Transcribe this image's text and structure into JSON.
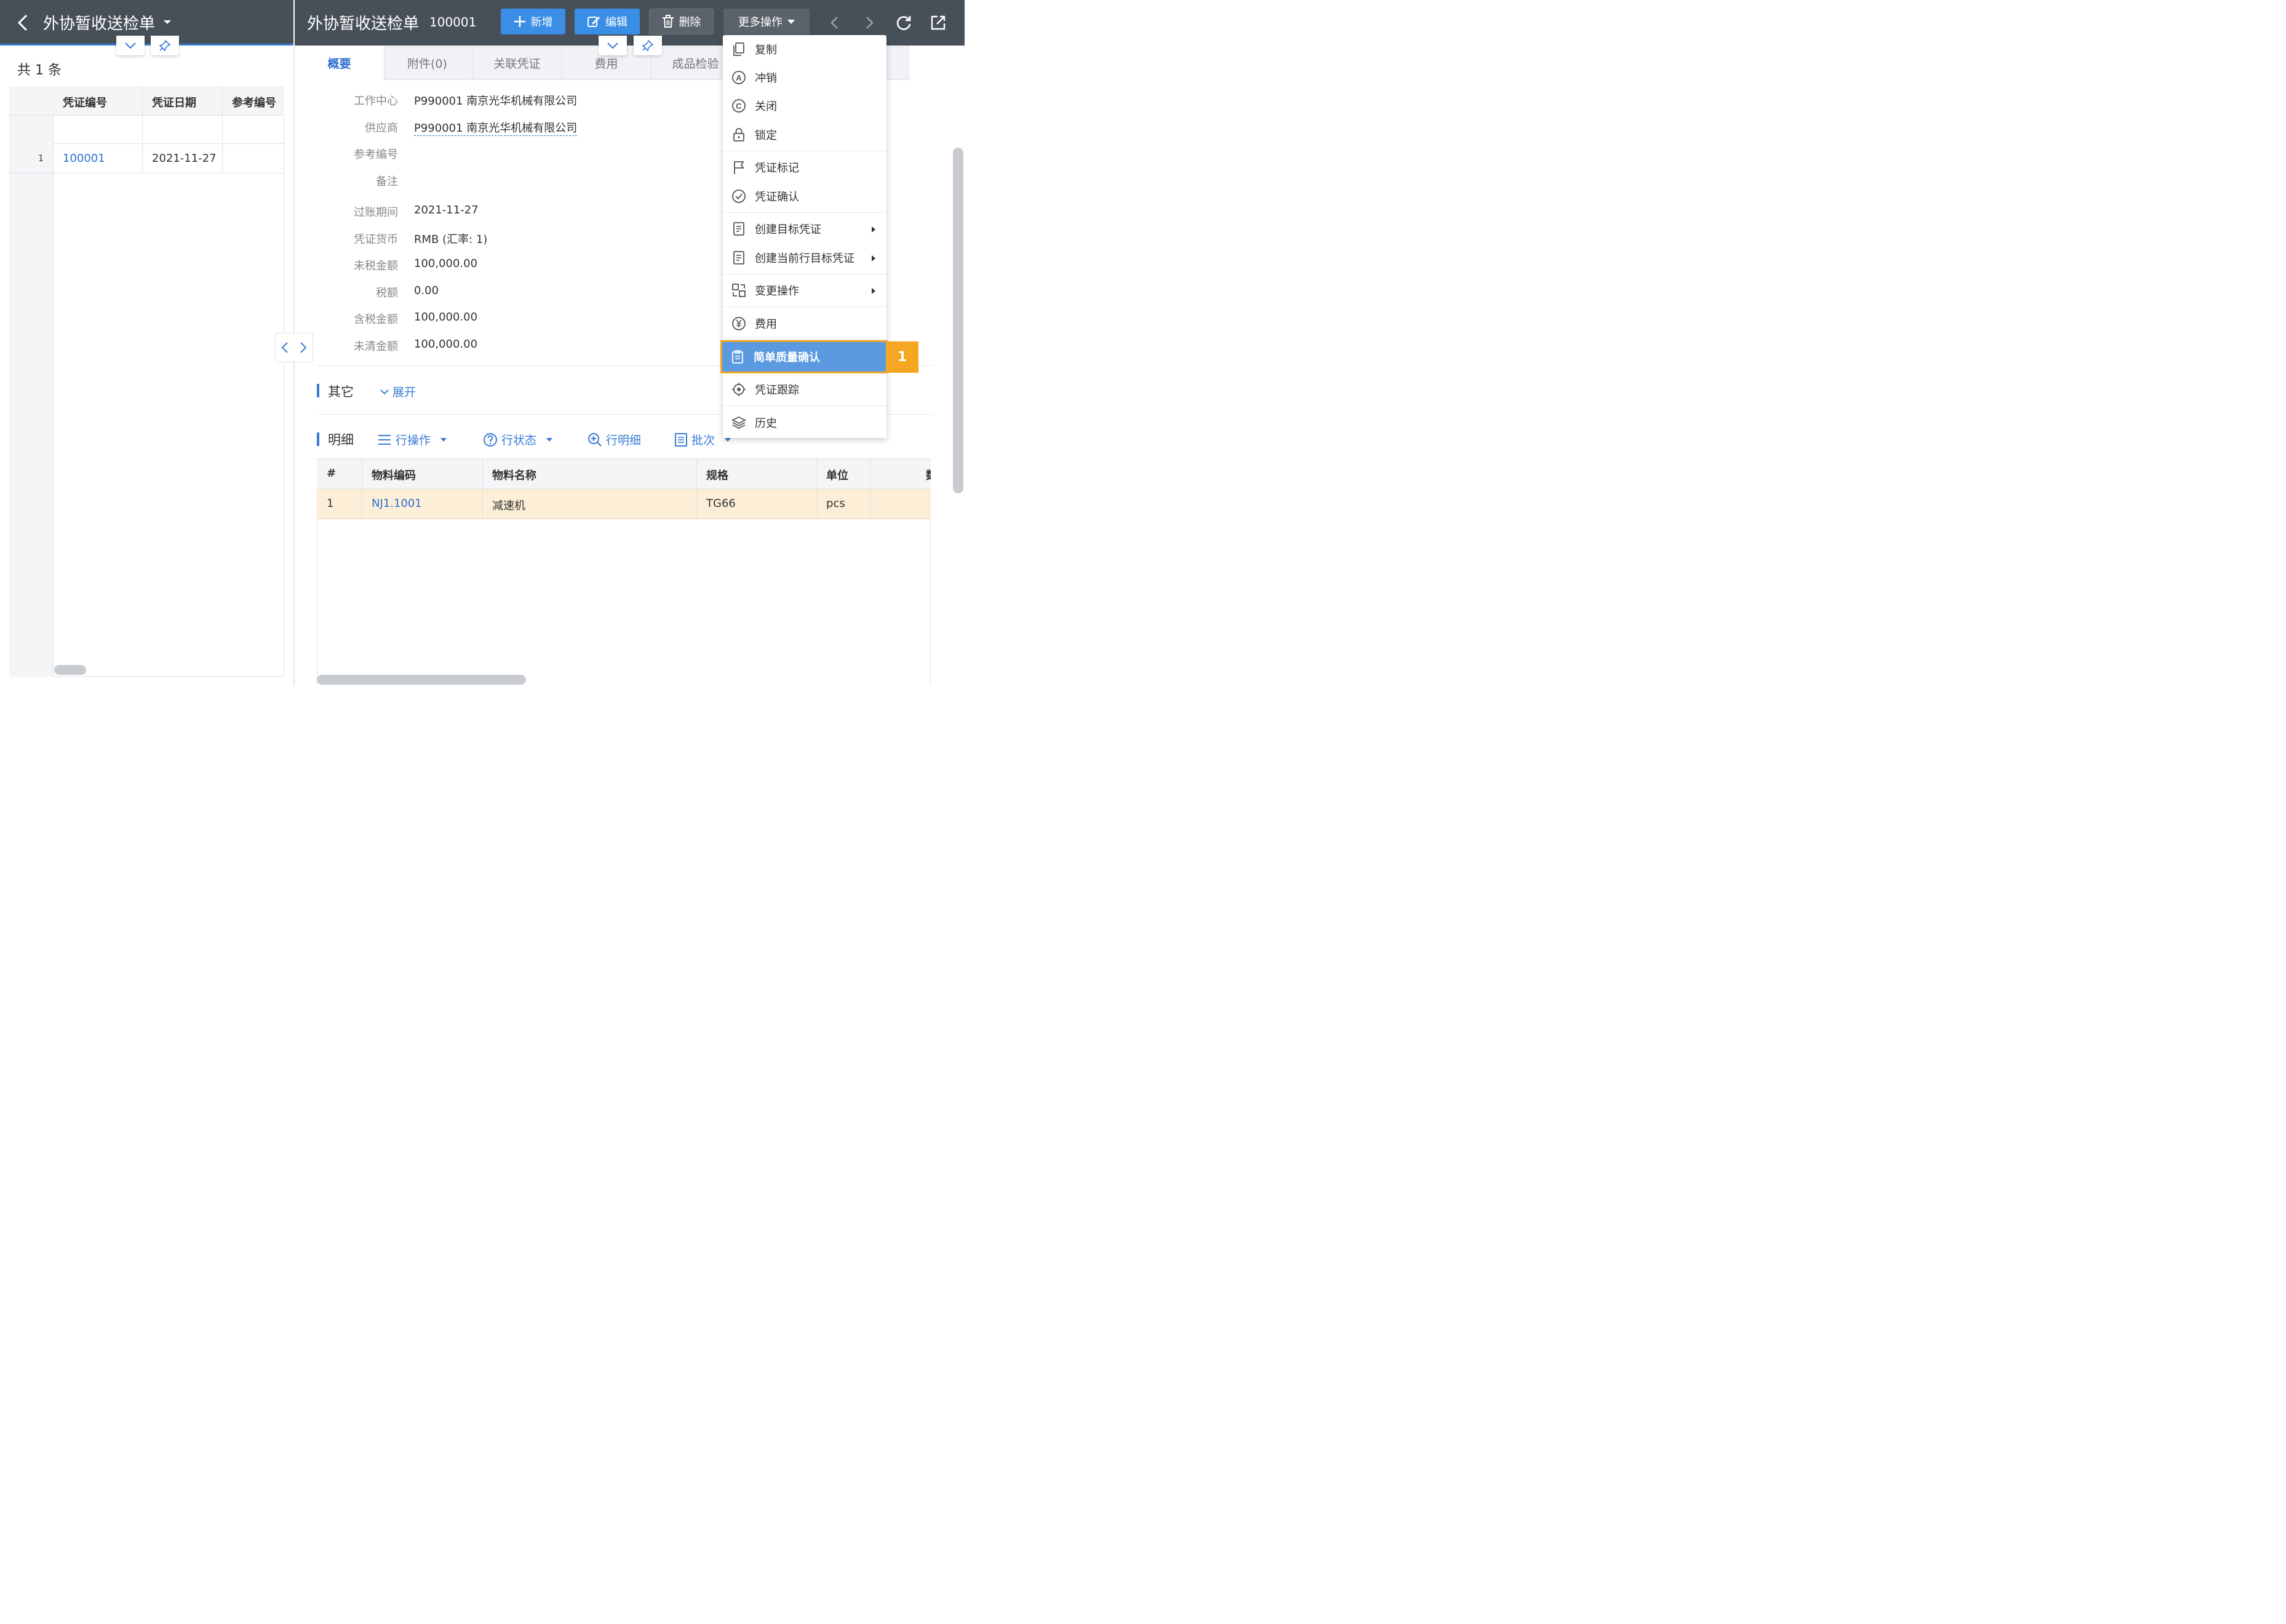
{
  "left": {
    "title": "外协暂收送检单",
    "count": "共 1 条",
    "columns": [
      "凭证编号",
      "凭证日期",
      "参考编号"
    ],
    "rows": [
      {
        "idx": "1",
        "no": "100001",
        "date": "2021-11-27",
        "ref": ""
      }
    ]
  },
  "header": {
    "title": "外协暂收送检单",
    "doc_no": "100001",
    "new_label": "新增",
    "edit_label": "编辑",
    "delete_label": "删除",
    "more_label": "更多操作"
  },
  "tabs": [
    "概要",
    "附件(0)",
    "关联凭证",
    "费用",
    "成品检验"
  ],
  "form": [
    {
      "label": "工作中心",
      "value": "P990001 南京光华机械有限公司"
    },
    {
      "label": "供应商",
      "value": "P990001 南京光华机械有限公司"
    },
    {
      "label": "参考编号",
      "value": ""
    },
    {
      "label": "备注",
      "value": ""
    },
    {
      "label": "过账期间",
      "value": "2021-11-27"
    },
    {
      "label": "凭证货币",
      "value": "RMB (汇率: 1)"
    },
    {
      "label": "未税金额",
      "value": "100,000.00"
    },
    {
      "label": "税额",
      "value": "0.00"
    },
    {
      "label": "含税金额",
      "value": "100,000.00"
    },
    {
      "label": "未清金额",
      "value": "100,000.00"
    }
  ],
  "other": {
    "title": "其它",
    "expand": "展开"
  },
  "detail": {
    "title": "明细",
    "tools": [
      "行操作",
      "行状态",
      "行明细",
      "批次"
    ],
    "columns": [
      "#",
      "物料编码",
      "物料名称",
      "规格",
      "单位",
      "数"
    ],
    "rows": [
      {
        "idx": "1",
        "code": "NJ1.1001",
        "name": "减速机",
        "spec": "TG66",
        "unit": "pcs"
      }
    ]
  },
  "menu": {
    "items": [
      {
        "label": "复制",
        "icon": "copy-icon"
      },
      {
        "label": "冲销",
        "icon": "reverse-icon"
      },
      {
        "label": "关闭",
        "icon": "close-circle-icon"
      },
      {
        "label": "锁定",
        "icon": "lock-icon"
      },
      {
        "label": "凭证标记",
        "icon": "flag-icon"
      },
      {
        "label": "凭证确认",
        "icon": "check-circle-icon"
      },
      {
        "label": "创建目标凭证",
        "icon": "document-icon"
      },
      {
        "label": "创建当前行目标凭证",
        "icon": "document-icon"
      },
      {
        "label": "变更操作",
        "icon": "change-icon"
      },
      {
        "label": "费用",
        "icon": "yen-icon"
      },
      {
        "label": "简单质量确认",
        "icon": "clipboard-icon"
      },
      {
        "label": "凭证跟踪",
        "icon": "target-icon"
      },
      {
        "label": "历史",
        "icon": "layers-icon"
      }
    ],
    "highlight_badge": "1"
  },
  "colors": {
    "header": "#475059",
    "primary": "#3a8ee6",
    "link": "#2f6fd1",
    "highlight": "#f5a623",
    "row_selected": "#fdefd7"
  }
}
